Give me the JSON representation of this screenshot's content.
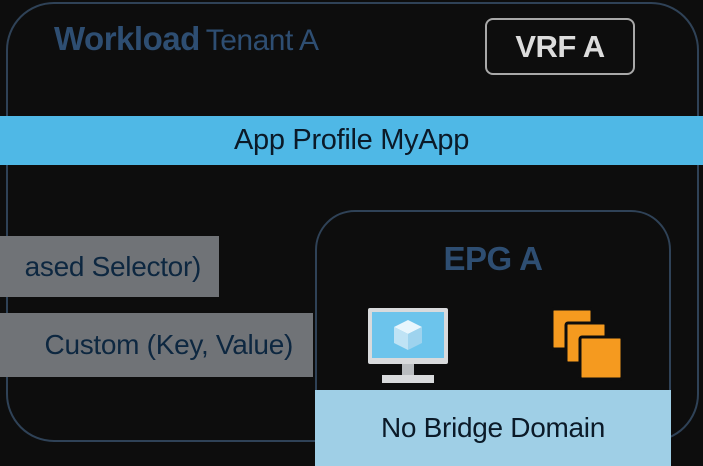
{
  "tenant": {
    "keyword": "Workload",
    "name": "Tenant A"
  },
  "vrf": {
    "label": "VRF A"
  },
  "app_profile": {
    "label": "App Profile MyApp"
  },
  "selectors": [
    {
      "label": "ased Selector)"
    },
    {
      "label": "Custom (Key, Value)"
    }
  ],
  "epg": {
    "title": "EPG A",
    "icons": [
      "virtual-machine-icon",
      "containers-icon"
    ]
  },
  "bridge_domain": {
    "label": "No Bridge Domain"
  },
  "colors": {
    "background": "#0d0d0d",
    "outline": "#2f4257",
    "title_blue": "#2e4e72",
    "app_profile_bar": "#4fb8e6",
    "bridge_domain_bar": "#9fcfe6",
    "selector_gray": "#707377",
    "container_orange": "#f59a1f",
    "vm_cube_blue": "#6cc4ec"
  }
}
